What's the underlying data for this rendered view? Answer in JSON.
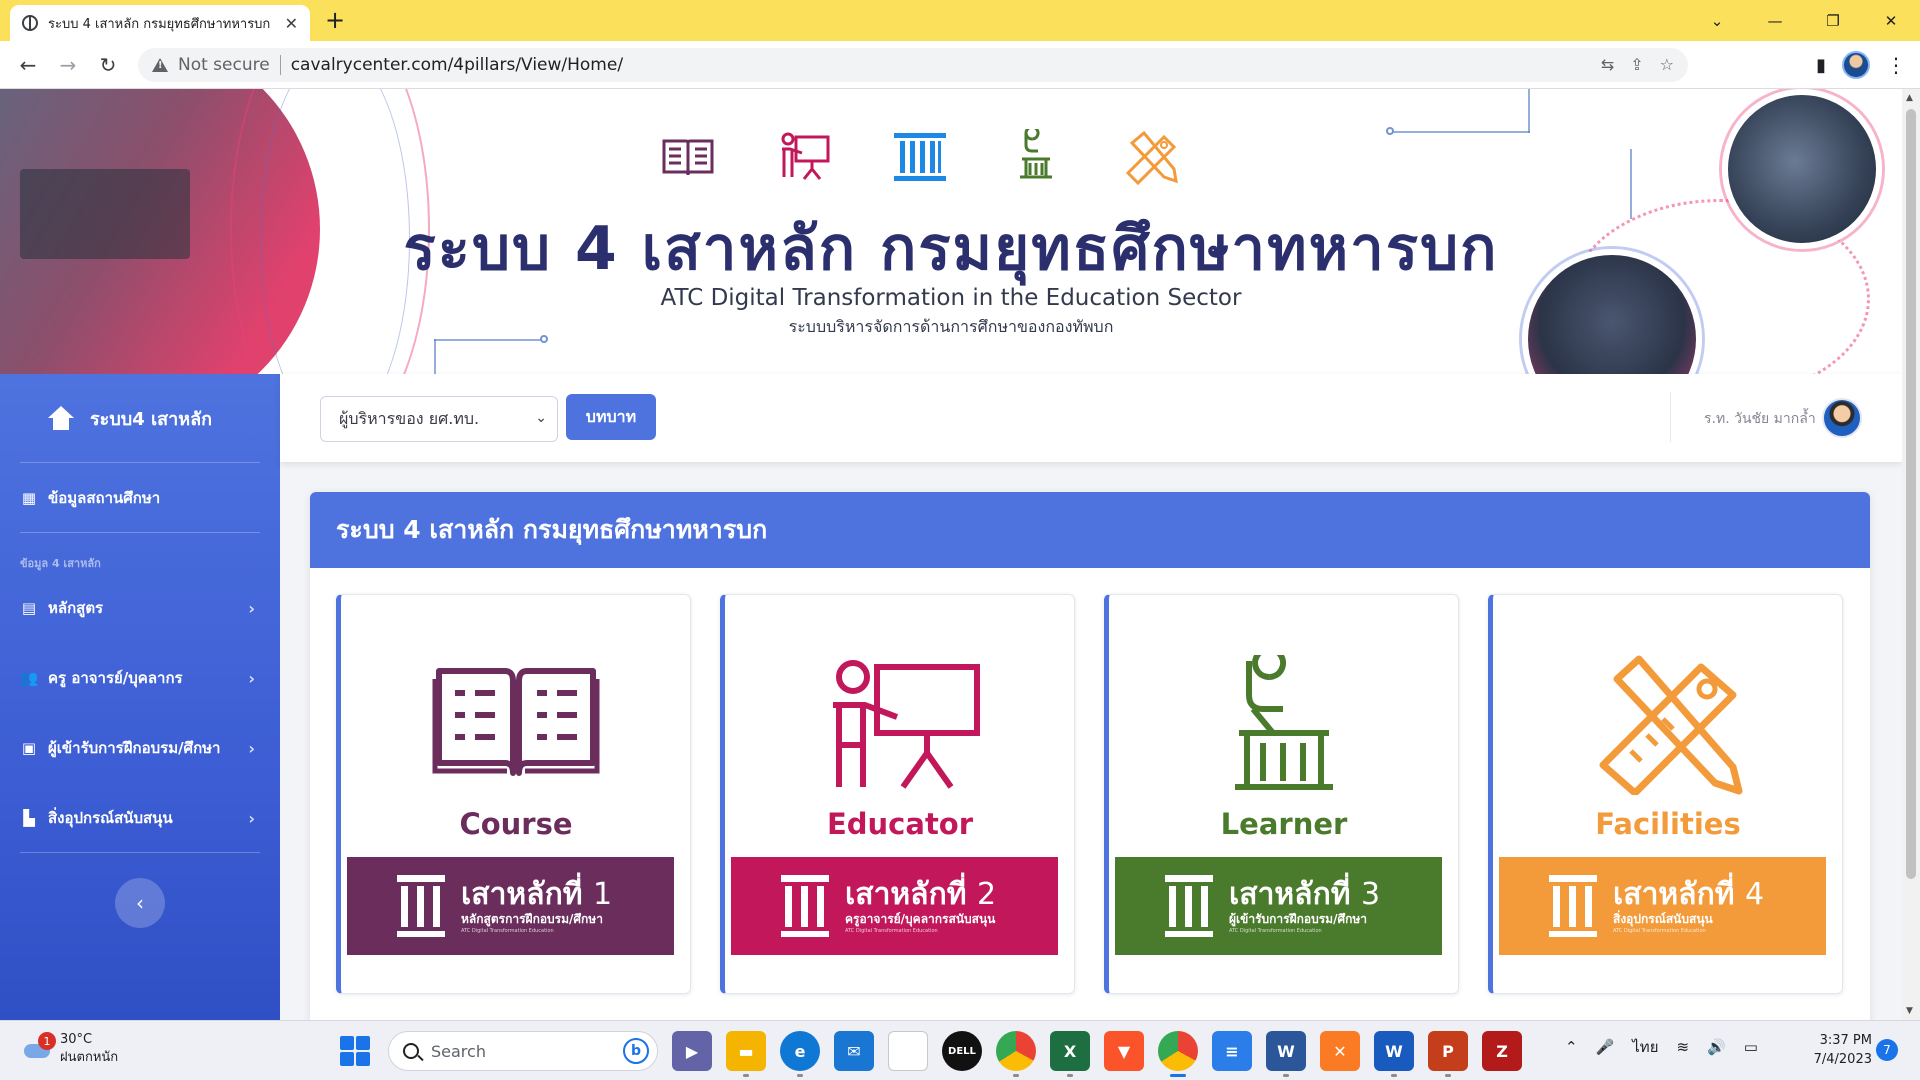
{
  "browser": {
    "tab_title": "ระบบ 4 เสาหลัก กรมยุทธศึกษาทหารบก",
    "new_tab": "+",
    "security_label": "Not secure",
    "url": "cavalrycenter.com/4pillars/View/Home/"
  },
  "banner": {
    "title": "ระบบ 4 เสาหลัก กรมยุทธศึกษาทหารบก",
    "subtitle_en": "ATC Digital Transformation in the Education Sector",
    "subtitle_th": "ระบบบริหารจัดการด้านการศึกษาของกองทัพบก",
    "icons": [
      "book-icon",
      "teacher-icon",
      "pillar-icon",
      "learner-icon",
      "facilities-icon"
    ]
  },
  "sidebar": {
    "brand": "ระบบ4 เสาหลัก",
    "school_info": "ข้อมูลสถานศึกษา",
    "section_heading": "ข้อมูล 4 เสาหลัก",
    "items": [
      {
        "label": "หลักสูตร",
        "icon": "card-icon"
      },
      {
        "label": "ครู อาจารย์/บุคลากร",
        "icon": "users-icon"
      },
      {
        "label": "ผู้เข้ารับการฝึกอบรม/ศึกษา",
        "icon": "id-card-icon"
      },
      {
        "label": "สิ่งอุปกรณ์สนับสนุน",
        "icon": "building-icon"
      }
    ],
    "toggle_icon": "chevron-left-icon"
  },
  "topbar": {
    "role_value": "ผู้บริหารของ ยศ.ทบ.",
    "role_button": "บทบาท",
    "user_name": "ร.ท. วันชัย มากล้ำ"
  },
  "main": {
    "header": "ระบบ 4 เสาหลัก กรมยุทธศึกษาทหารบก",
    "pillars": [
      {
        "name": "Course",
        "badge_title": "เสาหลักที่",
        "number": "1",
        "badge_sub": "หลักสูตรการฝึกอบรม/ศึกษา",
        "badge_tiny": "ATC Digital Transformation Education",
        "color": "#6b2d5c"
      },
      {
        "name": "Educator",
        "badge_title": "เสาหลักที่",
        "number": "2",
        "badge_sub": "ครูอาจารย์/บุคลากรสนับสนุน",
        "badge_tiny": "ATC Digital Transformation Education",
        "color": "#c2185b"
      },
      {
        "name": "Learner",
        "badge_title": "เสาหลักที่",
        "number": "3",
        "badge_sub": "ผู้เข้ารับการฝึกอบรม/ศึกษา",
        "badge_tiny": "ATC Digital Transformation Education",
        "color": "#4a7a2b"
      },
      {
        "name": "Facilities",
        "badge_title": "เสาหลักที่",
        "number": "4",
        "badge_sub": "สิ่งอุปกรณ์สนับสนุน",
        "badge_tiny": "ATC Digital Transformation Education",
        "color": "#f39a3a"
      }
    ]
  },
  "taskbar": {
    "weather_temp": "30°C",
    "weather_desc": "ฝนตกหนัก",
    "weather_badge": "1",
    "search_placeholder": "Search",
    "language": "ไทย",
    "time": "3:37 PM",
    "date": "7/4/2023",
    "notifications": "7"
  }
}
